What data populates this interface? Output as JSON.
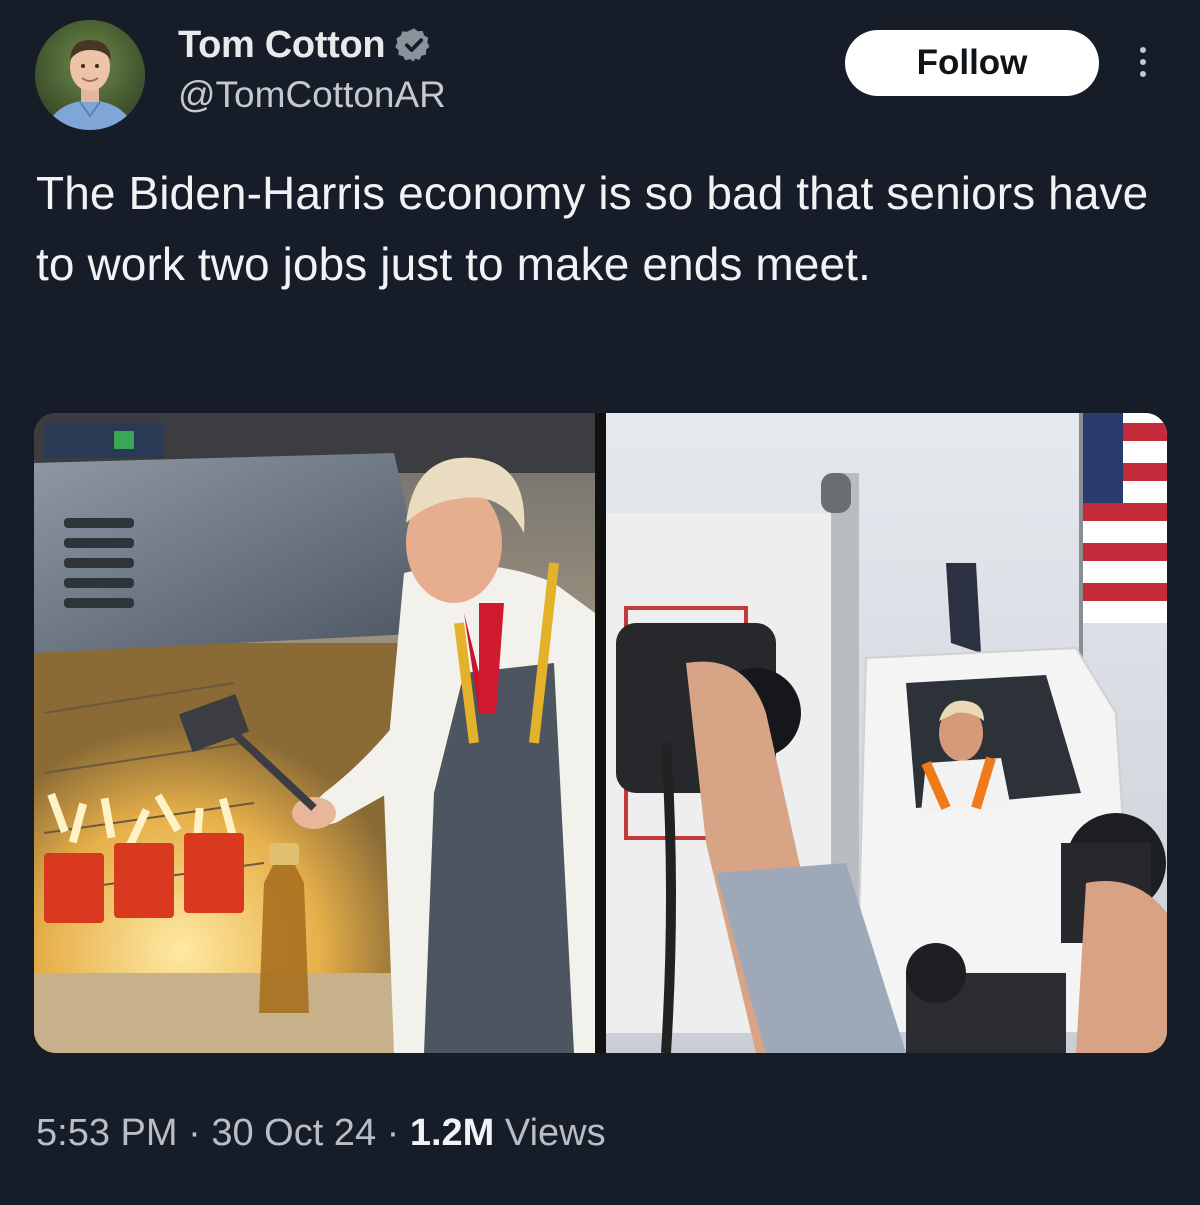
{
  "author": {
    "name": "Tom Cotton",
    "handle": "@TomCottonAR",
    "verified": true,
    "verified_icon": "verified-badge-icon"
  },
  "actions": {
    "follow_label": "Follow",
    "more_icon": "more-vertical-icon"
  },
  "tweet": {
    "text": "The Biden-Harris economy is so bad that seniors have to work two jobs just to make ends meet."
  },
  "media": {
    "images": [
      "photo-fast-food-fryer",
      "photo-garbage-truck"
    ]
  },
  "meta": {
    "time": "5:53 PM",
    "date": "30 Oct 24",
    "views_count": "1.2M",
    "views_label": "Views",
    "separator": "·"
  },
  "colors": {
    "background": "#161c28",
    "text": "#e7e9ea",
    "secondary_text": "#b9bec4",
    "verified": "#8a929b",
    "button_bg": "#ffffff"
  }
}
